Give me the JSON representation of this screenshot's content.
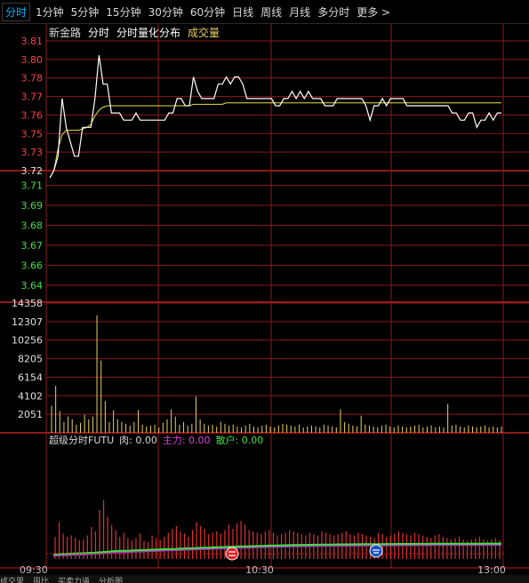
{
  "tabs": [
    {
      "label": "分时",
      "active": true
    },
    {
      "label": "1分钟"
    },
    {
      "label": "5分钟"
    },
    {
      "label": "15分钟"
    },
    {
      "label": "30分钟"
    },
    {
      "label": "60分钟"
    },
    {
      "label": "日线"
    },
    {
      "label": "周线"
    },
    {
      "label": "月线"
    },
    {
      "label": "多分时"
    },
    {
      "label": "更多 >"
    }
  ],
  "legend": {
    "stock_name": "新金路",
    "tab_intraday": "分时",
    "tab_dist": "分时量化分布",
    "vol_label": "成交量"
  },
  "indicator": {
    "title": "超级分时FUTU",
    "meat": "肉: 0.00",
    "main": "主力: 0.00",
    "retail": "散户: 0.00"
  },
  "bottom_tabs": [
    "成交里",
    "周比",
    "买卖力道",
    "分析图"
  ],
  "colors": {
    "up": "#ff4040",
    "down": "#40e040",
    "price_line": "#ffffff",
    "avg_line": "#e8e040",
    "grid": "#8b1a1a",
    "vol_bar": "#e8d060"
  },
  "chart_data": {
    "type": "line",
    "price_axis_up": [
      "3.81",
      "3.80",
      "3.78",
      "3.77",
      "3.76",
      "3.75",
      "3.73"
    ],
    "price_axis_ref": "3.72",
    "price_axis_down": [
      "3.71",
      "3.69",
      "3.68",
      "3.67",
      "3.66",
      "3.64"
    ],
    "volume_axis": [
      "14358",
      "12307",
      "10256",
      "8205",
      "6154",
      "4102",
      "2051"
    ],
    "time_labels": [
      "09:30",
      "10:30",
      "13:00"
    ],
    "ylim": [
      3.635,
      3.815
    ],
    "vol_max": 14358,
    "price": [
      3.715,
      3.72,
      3.73,
      3.77,
      3.75,
      3.74,
      3.73,
      3.73,
      3.75,
      3.75,
      3.75,
      3.77,
      3.8,
      3.78,
      3.78,
      3.76,
      3.76,
      3.76,
      3.755,
      3.755,
      3.755,
      3.76,
      3.755,
      3.755,
      3.755,
      3.755,
      3.755,
      3.755,
      3.755,
      3.76,
      3.76,
      3.77,
      3.77,
      3.765,
      3.765,
      3.785,
      3.775,
      3.77,
      3.77,
      3.77,
      3.77,
      3.78,
      3.78,
      3.785,
      3.78,
      3.785,
      3.785,
      3.78,
      3.77,
      3.77,
      3.77,
      3.77,
      3.77,
      3.77,
      3.77,
      3.765,
      3.765,
      3.77,
      3.77,
      3.775,
      3.77,
      3.775,
      3.77,
      3.775,
      3.77,
      3.77,
      3.77,
      3.765,
      3.765,
      3.765,
      3.77,
      3.77,
      3.77,
      3.77,
      3.77,
      3.77,
      3.77,
      3.765,
      3.755,
      3.765,
      3.765,
      3.77,
      3.765,
      3.77,
      3.77,
      3.77,
      3.77,
      3.765,
      3.765,
      3.765,
      3.765,
      3.765,
      3.765,
      3.765,
      3.765,
      3.765,
      3.765,
      3.765,
      3.76,
      3.76,
      3.755,
      3.755,
      3.76,
      3.76,
      3.75,
      3.755,
      3.755,
      3.76,
      3.755,
      3.76,
      3.76
    ],
    "avg": [
      3.715,
      3.72,
      3.735,
      3.745,
      3.748,
      3.748,
      3.748,
      3.748,
      3.749,
      3.75,
      3.752,
      3.758,
      3.762,
      3.764,
      3.765,
      3.765,
      3.765,
      3.765,
      3.765,
      3.765,
      3.765,
      3.765,
      3.765,
      3.765,
      3.765,
      3.765,
      3.765,
      3.765,
      3.765,
      3.765,
      3.765,
      3.765,
      3.765,
      3.765,
      3.765,
      3.766,
      3.766,
      3.766,
      3.766,
      3.766,
      3.766,
      3.766,
      3.766,
      3.767,
      3.767,
      3.767,
      3.767,
      3.767,
      3.767,
      3.767,
      3.767,
      3.767,
      3.767,
      3.767,
      3.767,
      3.767,
      3.767,
      3.767,
      3.767,
      3.767,
      3.767,
      3.767,
      3.767,
      3.767,
      3.767,
      3.767,
      3.767,
      3.767,
      3.767,
      3.767,
      3.767,
      3.767,
      3.767,
      3.767,
      3.767,
      3.767,
      3.767,
      3.767,
      3.767,
      3.767,
      3.767,
      3.767,
      3.767,
      3.767,
      3.767,
      3.767,
      3.767,
      3.767,
      3.767,
      3.767,
      3.767,
      3.767,
      3.767,
      3.767,
      3.767,
      3.767,
      3.767,
      3.767,
      3.767,
      3.767,
      3.767,
      3.767,
      3.767,
      3.767,
      3.767,
      3.767,
      3.767,
      3.767,
      3.767,
      3.767,
      3.767
    ],
    "volume": [
      3000,
      5200,
      2400,
      1200,
      1800,
      1500,
      900,
      1100,
      2000,
      1500,
      1800,
      13000,
      8000,
      3500,
      1200,
      2500,
      1500,
      1200,
      1000,
      800,
      1200,
      2500,
      900,
      700,
      800,
      900,
      600,
      1100,
      1500,
      2600,
      1800,
      900,
      1200,
      800,
      1000,
      4000,
      1500,
      1000,
      800,
      900,
      700,
      1200,
      1000,
      800,
      900,
      700,
      600,
      800,
      1000,
      700,
      600,
      800,
      900,
      700,
      600,
      800,
      1000,
      900,
      800,
      700,
      900,
      600,
      700,
      800,
      700,
      600,
      900,
      800,
      700,
      600,
      2600,
      1200,
      1000,
      800,
      700,
      1900,
      900,
      800,
      700,
      600,
      800,
      900,
      700,
      600,
      800,
      700,
      600,
      700,
      800,
      900,
      600,
      700,
      800,
      600,
      700,
      600,
      3200,
      800,
      900,
      700,
      600,
      800,
      700,
      600,
      700,
      800,
      600,
      700,
      600,
      700
    ],
    "indicator_bars": [
      20,
      42,
      25,
      20,
      22,
      18,
      15,
      16,
      22,
      35,
      28,
      60,
      75,
      50,
      38,
      30,
      20,
      26,
      18,
      15,
      18,
      25,
      14,
      12,
      22,
      18,
      15,
      20,
      26,
      32,
      36,
      28,
      25,
      20,
      30,
      42,
      36,
      32,
      24,
      26,
      28,
      25,
      30,
      38,
      32,
      40,
      44,
      38,
      30,
      28,
      26,
      24,
      28,
      30,
      26,
      22,
      24,
      26,
      30,
      28,
      26,
      24,
      22,
      26,
      24,
      22,
      28,
      26,
      24,
      22,
      24,
      26,
      28,
      24,
      22,
      26,
      24,
      22,
      20,
      18,
      26,
      24,
      20,
      22,
      24,
      28,
      26,
      24,
      22,
      26,
      24,
      22,
      20,
      18,
      22,
      24,
      20,
      18,
      16,
      18,
      20,
      16,
      14,
      16,
      18,
      20,
      16,
      14,
      16,
      18,
      15
    ],
    "indicator_main": [
      0,
      0.5,
      1,
      1.2,
      1.5,
      1.8,
      2,
      2.2,
      2.5,
      2.8,
      3,
      3.5,
      4,
      4.5,
      5,
      5.5,
      5.8,
      6,
      6.2,
      6.5,
      6.8,
      7,
      7.2,
      7.5,
      7.8,
      8,
      8.2,
      8.5,
      8.8,
      9,
      9.2,
      9.5,
      9.8,
      10,
      10.2,
      10.5,
      10.8,
      11,
      11.2,
      11.5,
      11.8,
      12,
      12.2,
      12.4,
      12.6,
      12.8,
      13,
      13.2,
      13.4,
      13.6,
      13.8,
      14,
      14.2,
      14.4,
      14.5,
      14.6,
      14.8,
      15,
      15.2,
      15.3,
      15.4,
      15.5,
      15.6,
      15.7,
      15.8,
      15.9,
      16,
      16.1,
      16.2,
      16.3,
      16.4,
      16.4,
      16.5,
      16.5,
      16.6,
      16.6,
      16.7,
      16.7,
      16.8,
      16.8,
      16.9,
      16.9,
      17,
      17,
      17,
      17.1,
      17.1,
      17.2,
      17.2,
      17.2,
      17.3,
      17.3,
      17.3,
      17.4,
      17.4,
      17.4,
      17.5,
      17.5,
      17.5,
      17.5,
      17.6,
      17.6,
      17.6,
      17.6,
      17.6,
      17.7,
      17.7,
      17.7,
      17.7,
      17.7,
      17.7
    ]
  }
}
